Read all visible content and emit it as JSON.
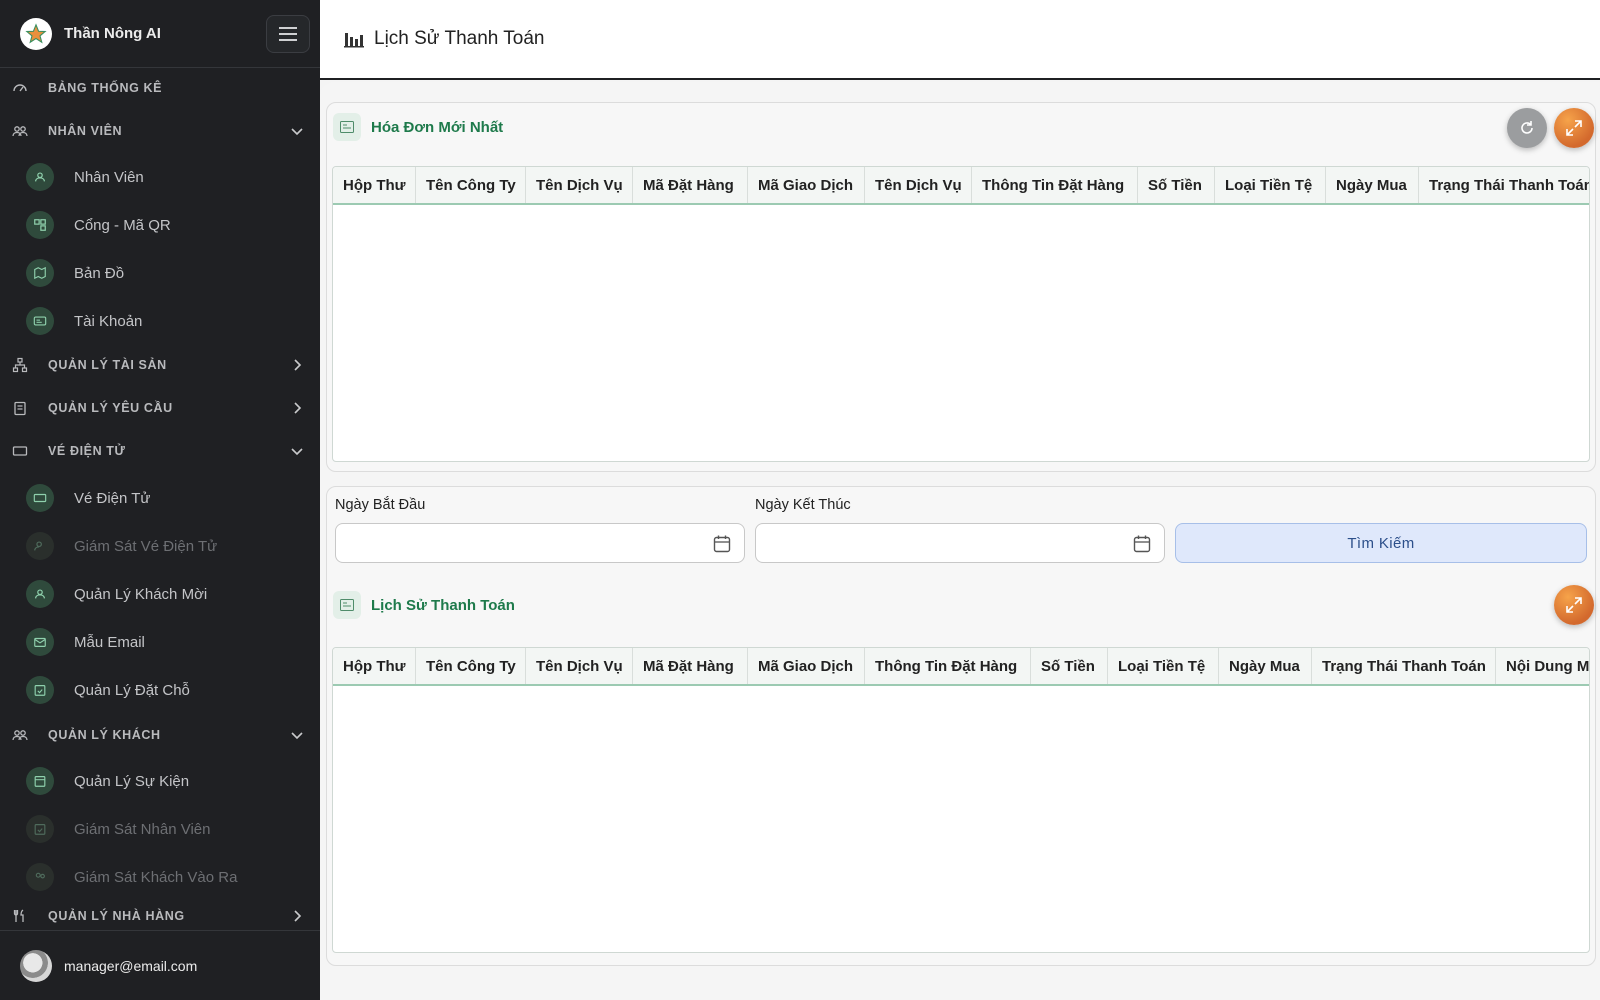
{
  "app": {
    "name": "Thần Nông AI"
  },
  "header": {
    "title": "Lịch Sử Thanh Toán"
  },
  "sidebar": {
    "sections": {
      "dashboard": "BẢNG THỐNG KÊ",
      "staff": "NHÂN VIÊN",
      "assets": "QUẢN LÝ TÀI SẢN",
      "requests": "QUẢN LÝ YÊU CẦU",
      "eticket": "VÉ ĐIỆN TỬ",
      "guests": "QUẢN LÝ KHÁCH",
      "restaurant": "QUẢN LÝ NHÀ HÀNG"
    },
    "items": {
      "staff": "Nhân Viên",
      "gate_qr": "Cổng - Mã QR",
      "map": "Bản Đồ",
      "account": "Tài Khoản",
      "eticket": "Vé Điện Tử",
      "eticket_monitor": "Giám Sát Vé Điện Tử",
      "invited_guests": "Quản Lý Khách Mời",
      "email_template": "Mẫu Email",
      "booking": "Quản Lý Đặt Chỗ",
      "events": "Quản Lý Sự Kiện",
      "staff_monitor": "Giám Sát Nhân Viên",
      "guest_inout_monitor": "Giám Sát Khách Vào Ra"
    },
    "user_email": "manager@email.com"
  },
  "latest_invoices": {
    "title": "Hóa Đơn Mới Nhất",
    "columns": [
      "Hộp Thư",
      "Tên Công Ty",
      "Tên Dịch Vụ",
      "Mã Đặt Hàng",
      "Mã Giao Dịch",
      "Tên Dịch Vụ",
      "Thông Tin Đặt Hàng",
      "Số Tiền",
      "Loại Tiền Tệ",
      "Ngày Mua",
      "Trạng Thái Thanh Toán"
    ]
  },
  "filters": {
    "start_label": "Ngày Bắt Đầu",
    "start_value": "",
    "end_label": "Ngày Kết Thúc",
    "end_value": "",
    "search_label": "Tìm Kiếm"
  },
  "payment_history": {
    "title": "Lịch Sử Thanh Toán",
    "columns": [
      "Hộp Thư",
      "Tên Công Ty",
      "Tên Dịch Vụ",
      "Mã Đặt Hàng",
      "Mã Giao Dịch",
      "Thông Tin Đặt Hàng",
      "Số Tiền",
      "Loại Tiền Tệ",
      "Ngày Mua",
      "Trạng Thái Thanh Toán",
      "Nội Dung M"
    ]
  },
  "colors": {
    "sidebar_bg": "#1f2023",
    "accent_green": "#1e7a4b",
    "accent_orange": "#e07b35",
    "search_bg": "#dfe8fb"
  }
}
